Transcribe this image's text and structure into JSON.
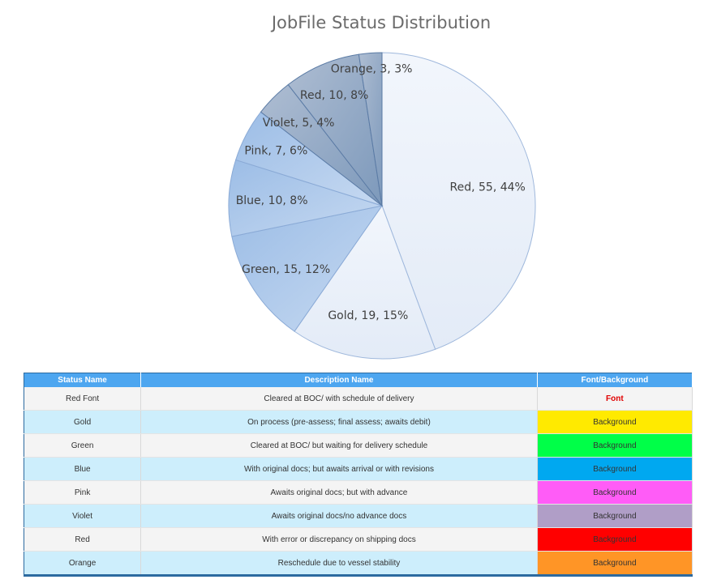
{
  "chart_data": {
    "type": "pie",
    "title": "JobFile Status Distribution",
    "slices": [
      {
        "name": "Red",
        "value": 55,
        "percent": "44%",
        "label": "Red, 55, 44%"
      },
      {
        "name": "Gold",
        "value": 19,
        "percent": "15%",
        "label": "Gold, 19, 15%"
      },
      {
        "name": "Green",
        "value": 15,
        "percent": "12%",
        "label": "Green, 15, 12%"
      },
      {
        "name": "Blue",
        "value": 10,
        "percent": "8%",
        "label": "Blue, 10, 8%"
      },
      {
        "name": "Pink",
        "value": 7,
        "percent": "6%",
        "label": "Pink, 7, 6%"
      },
      {
        "name": "Violet",
        "value": 5,
        "percent": "4%",
        "label": "Violet, 5, 4%"
      },
      {
        "name": "Red",
        "value": 10,
        "percent": "8%",
        "label": "Red, 10, 8%"
      },
      {
        "name": "Orange",
        "value": 3,
        "percent": "3%",
        "label": "Orange, 3, 3%"
      }
    ],
    "colors": {
      "light": [
        "#f2f6fc",
        "#e3ebf7"
      ],
      "medium": [
        "#c6d9f1",
        "#9cbde6"
      ],
      "dark": [
        "#aebdd2",
        "#7d99bb"
      ],
      "stroke": [
        "#9fb8dc",
        "#8aaad6",
        "#5b7ba5"
      ]
    }
  },
  "legend_table": {
    "headers": [
      "Status Name",
      "Description Name",
      "Font/Background"
    ],
    "rows": [
      {
        "status": "Red Font",
        "description": "Cleared at BOC/ with schedule of delivery",
        "style": "Font",
        "color": "#e00000",
        "kind": "font"
      },
      {
        "status": "Gold",
        "description": "On process (pre-assess; final assess; awaits debit)",
        "style": "Background",
        "color": "#ffea00",
        "kind": "background"
      },
      {
        "status": "Green",
        "description": "Cleared at BOC/ but waiting for delivery schedule",
        "style": "Background",
        "color": "#00ff48",
        "kind": "background"
      },
      {
        "status": "Blue",
        "description": "With original docs; but awaits arrival or with revisions",
        "style": "Background",
        "color": "#00a8f0",
        "kind": "background"
      },
      {
        "status": "Pink",
        "description": "Awaits original docs; but with advance",
        "style": "Background",
        "color": "#ff5cf7",
        "kind": "background"
      },
      {
        "status": "Violet",
        "description": "Awaits original docs/no advance docs",
        "style": "Background",
        "color": "#b09ec7",
        "kind": "background"
      },
      {
        "status": "Red",
        "description": "With error or discrepancy on shipping docs",
        "style": "Background",
        "color": "#ff0000",
        "kind": "background"
      },
      {
        "status": "Orange",
        "description": "Reschedule due to vessel stability",
        "style": "Background",
        "color": "#ff9526",
        "kind": "background"
      }
    ]
  }
}
